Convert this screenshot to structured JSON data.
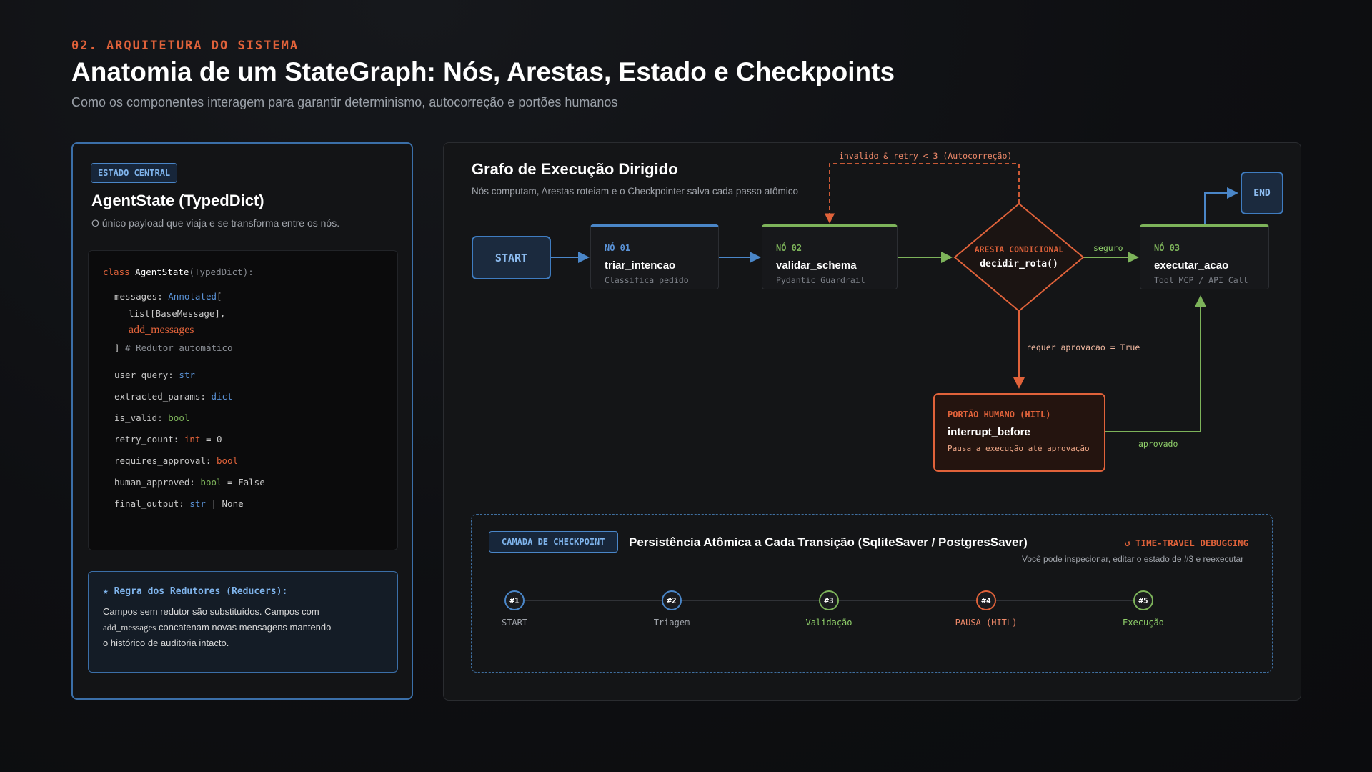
{
  "header": {
    "kicker": "02. ARQUITETURA DO SISTEMA",
    "title": "Anatomia de um StateGraph: Nós, Arestas, Estado e Checkpoints",
    "subtitle": "Como os componentes interagem para garantir determinismo, autocorreção e portões humanos"
  },
  "state_panel": {
    "badge": "ESTADO CENTRAL",
    "title": "AgentState (TypedDict)",
    "description": "O único payload que viaja e se transforma entre os nós.",
    "code": {
      "kw_class": "class",
      "class_name": "AgentState",
      "class_base": "(TypedDict):",
      "messages_key": "messages: ",
      "messages_type": "Annotated",
      "messages_open": "[",
      "messages_list": "list[BaseMessage],",
      "messages_reducer": "add_messages",
      "messages_close": "]",
      "messages_comment": "# Redutor automático",
      "user_query_key": "user_query: ",
      "user_query_type": "str",
      "extracted_params_key": "extracted_params: ",
      "extracted_params_type": "dict",
      "is_valid_key": "is_valid: ",
      "is_valid_type": "bool",
      "retry_count_key": "retry_count: ",
      "retry_count_type": "int",
      "retry_count_default": " = 0",
      "requires_approval_key": "requires_approval: ",
      "requires_approval_type": "bool",
      "human_approved_key": "human_approved: ",
      "human_approved_type": "bool",
      "human_approved_default": " = False",
      "final_output_key": "final_output: ",
      "final_output_type": "str",
      "final_output_default": " | None"
    },
    "reducer": {
      "title": "★ Regra dos Redutores (Reducers):",
      "line1": "Campos sem redutor são substituídos. Campos com",
      "line2_code": "add_messages",
      "line2_rest": " concatenam novas mensagens mantendo",
      "line3": "o histórico de auditoria intacto."
    }
  },
  "graph": {
    "title": "Grafo de Execução Dirigido",
    "description": "Nós computam, Arestas roteiam e o Checkpointer salva cada passo atômico",
    "start_label": "START",
    "end_label": "END",
    "nodes": [
      {
        "label": "NÓ 01",
        "name": "triar_intencao",
        "sub": "Classifica pedido"
      },
      {
        "label": "NÓ 02",
        "name": "validar_schema",
        "sub": "Pydantic Guardrail"
      },
      {
        "label": "NÓ 03",
        "name": "executar_acao",
        "sub": "Tool MCP / API Call"
      }
    ],
    "conditional": {
      "label": "ARESTA CONDICIONAL",
      "name": "decidir_rota()"
    },
    "edges": {
      "retry": "invalido & retry < 3 (Autocorreção)",
      "safe": "seguro",
      "approval": "requer_aprovacao = True",
      "approved": "aprovado"
    },
    "hitl": {
      "label": "PORTÃO HUMANO (HITL)",
      "name": "interrupt_before",
      "sub": "Pausa a execução até aprovação"
    },
    "colors": {
      "blue": "#4a86c8",
      "green": "#7db35a",
      "orange": "#e0623a"
    }
  },
  "checkpoint": {
    "badge": "CAMADA DE CHECKPOINT",
    "title": "Persistência Atômica a Cada Transição (SqliteSaver / PostgresSaver)",
    "time_travel": "↺ TIME-TRAVEL DEBUGGING",
    "time_travel_desc": "Você pode inspecionar, editar o estado de #3 e reexecutar",
    "steps": [
      {
        "num": "#1",
        "label": "START",
        "color": "#4a86c8",
        "label_color": "#a0a4ab"
      },
      {
        "num": "#2",
        "label": "Triagem",
        "color": "#4a86c8",
        "label_color": "#a0a4ab"
      },
      {
        "num": "#3",
        "label": "Validação",
        "color": "#7db35a",
        "label_color": "#8fcf6a"
      },
      {
        "num": "#4",
        "label": "PAUSA (HITL)",
        "color": "#e0623a",
        "label_color": "#f08a6a"
      },
      {
        "num": "#5",
        "label": "Execução",
        "color": "#7db35a",
        "label_color": "#8fcf6a"
      }
    ]
  }
}
